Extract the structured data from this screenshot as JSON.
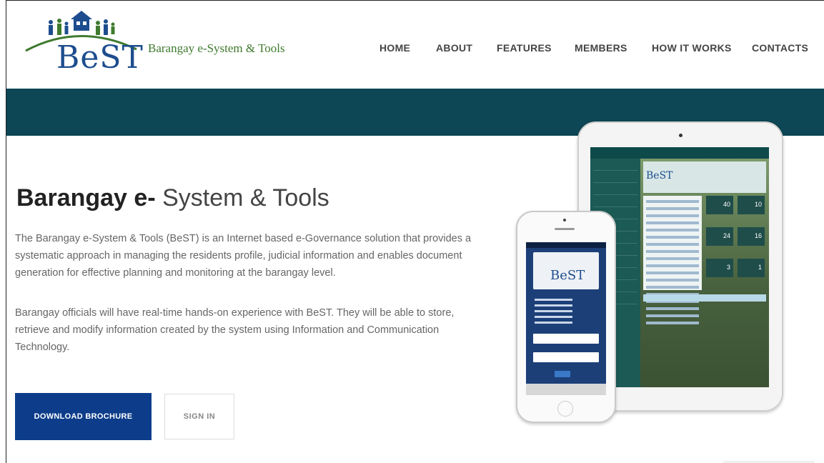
{
  "brand": {
    "logo_text": "BeST",
    "tagline": "Barangay e-System & Tools",
    "colors": {
      "logo_blue": "#1d4d8e",
      "logo_green": "#3f7a2e",
      "band_teal": "#0d4654",
      "button_blue": "#0d3d8a"
    }
  },
  "nav": {
    "items": [
      {
        "label": "HOME"
      },
      {
        "label": "ABOUT"
      },
      {
        "label": "FEATURES"
      },
      {
        "label": "MEMBERS"
      },
      {
        "label": "HOW IT WORKS"
      },
      {
        "label": "CONTACTS"
      }
    ]
  },
  "hero": {
    "title_bold": "Barangay e-",
    "title_light": " System & Tools",
    "paragraph_1": "The Barangay e-System & Tools (BeST) is an Internet based e-Governance solution that provides a systematic approach in managing the residents profile, judicial information and enables document generation for effective planning and monitoring at the barangay level.",
    "paragraph_2": "Barangay officials will have real-time hands-on experience with BeST. They will be able to store, retrieve and modify information created by the system using Information and Communication Technology.",
    "download_label": "DOWNLOAD BROCHURE",
    "signin_label": "SIGN IN"
  },
  "devices": {
    "tablet_logo": "BeST",
    "phone_logo": "BeST",
    "tile_numbers": [
      "40",
      "10",
      "24",
      "16",
      "3",
      "1"
    ]
  }
}
